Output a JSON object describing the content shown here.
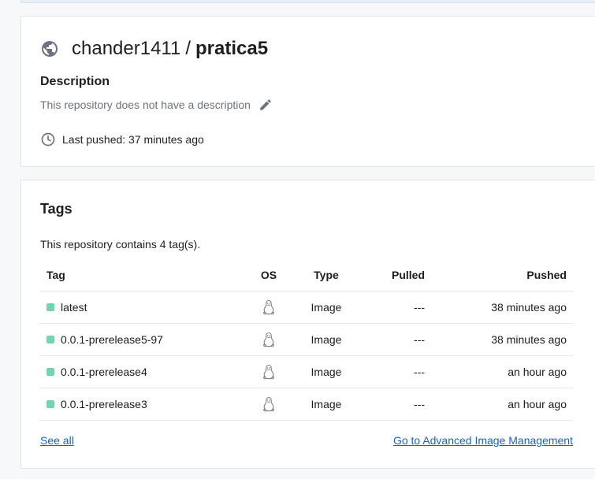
{
  "repo": {
    "owner": "chander1411",
    "separator": "/",
    "name": "pratica5",
    "description_label": "Description",
    "description_text": "This repository does not have a description",
    "last_pushed": "Last pushed: 37 minutes ago"
  },
  "tags": {
    "title": "Tags",
    "count_text": "This repository contains 4 tag(s).",
    "columns": {
      "tag": "Tag",
      "os": "OS",
      "type": "Type",
      "pulled": "Pulled",
      "pushed": "Pushed"
    },
    "rows": [
      {
        "tag": "latest",
        "os": "linux-icon",
        "type": "Image",
        "pulled": "---",
        "pushed": "38 minutes ago"
      },
      {
        "tag": "0.0.1-prerelease5-97",
        "os": "linux-icon",
        "type": "Image",
        "pulled": "---",
        "pushed": "38 minutes ago"
      },
      {
        "tag": "0.0.1-prerelease4",
        "os": "linux-icon",
        "type": "Image",
        "pulled": "---",
        "pushed": "an hour ago"
      },
      {
        "tag": "0.0.1-prerelease3",
        "os": "linux-icon",
        "type": "Image",
        "pulled": "---",
        "pushed": "an hour ago"
      }
    ],
    "see_all": "See all",
    "advanced_link": "Go to Advanced Image Management"
  },
  "colors": {
    "status_dot": "#74d3b0",
    "link": "#1565c0"
  }
}
